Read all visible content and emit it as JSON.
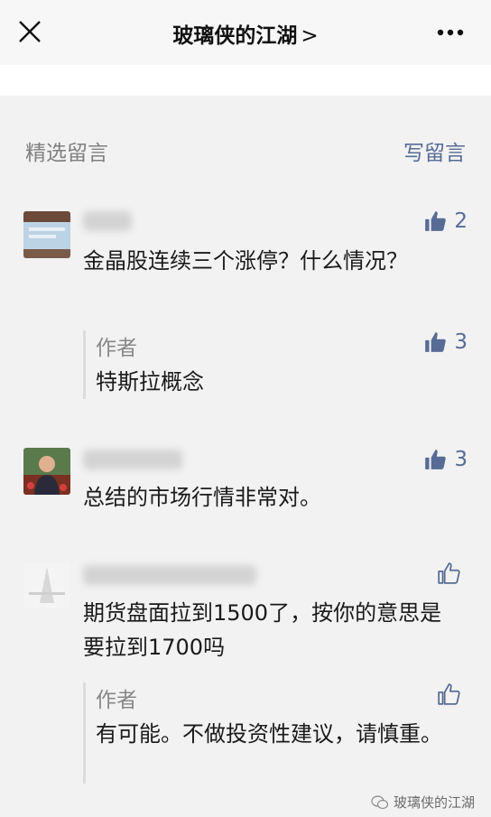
{
  "header": {
    "title": "玻璃侠的江湖",
    "chevron": ">"
  },
  "section": {
    "title": "精选留言",
    "write_label": "写留言"
  },
  "comments": [
    {
      "text": "金晶股连续三个涨停？什么情况？",
      "likes": "2",
      "reply": {
        "author": "作者",
        "text": "特斯拉概念",
        "likes": "3"
      }
    },
    {
      "text": "总结的市场行情非常对。",
      "likes": "3"
    },
    {
      "text": "期货盘面拉到1500了，按你的意思是要拉到1700吗",
      "likes": "",
      "reply": {
        "author": "作者",
        "text": "有可能。不做投资性建议，请慎重。",
        "likes": ""
      }
    }
  ],
  "watermark": {
    "text": "玻璃侠的江湖"
  },
  "colors": {
    "link": "#576b95",
    "muted": "#888888",
    "background": "#f2f2f2"
  }
}
